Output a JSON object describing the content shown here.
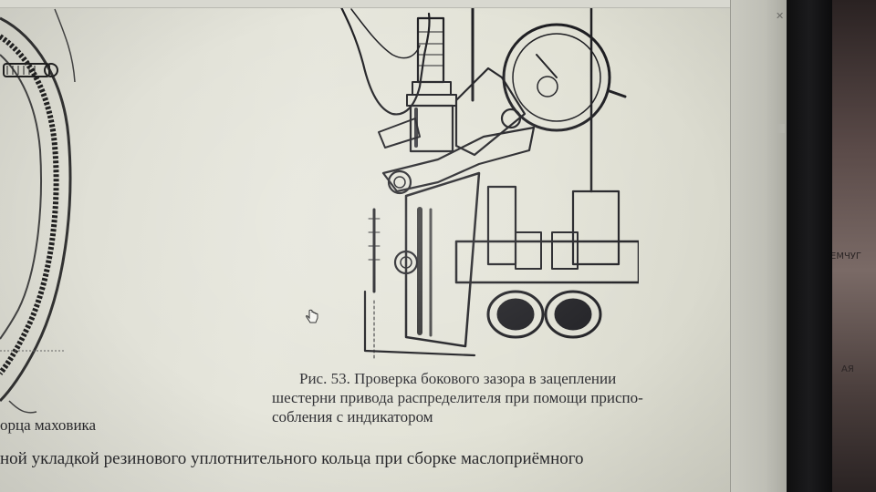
{
  "caption": {
    "line1": "Рис. 53. Проверка бокового зазора в зацеплении",
    "line2": "шестерни привода распределителя при помощи приспо-",
    "line3": "собления с индикатором"
  },
  "left_partial_caption": "орца маховика",
  "bottom_body_text": "ной укладкой резинового уплотнительного кольца при сборке маслоприёмного",
  "background_labels": {
    "top": "ЕМЧУГ",
    "bottom": "АЯ"
  },
  "icons": {
    "cursor": "hand-cursor-icon",
    "close": "close-icon"
  },
  "colors": {
    "paper": "#e2e2d8",
    "ink": "#2b2b2e",
    "bezel": "#141416"
  }
}
